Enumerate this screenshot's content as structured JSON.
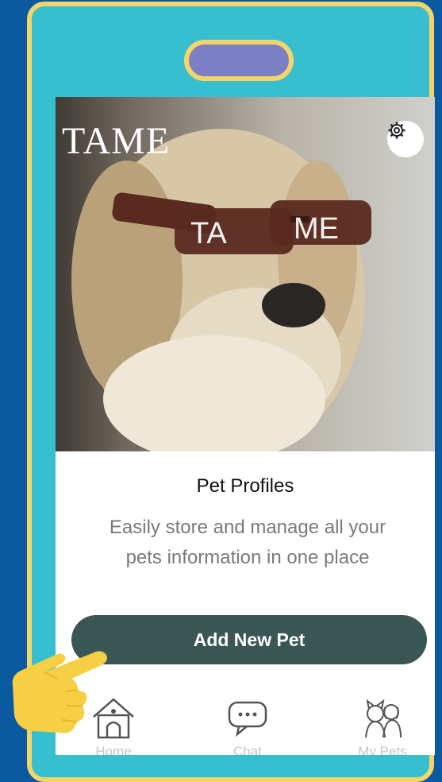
{
  "app": {
    "brand": "TAME"
  },
  "hero": {
    "glasses_left": "TA",
    "glasses_right": "ME"
  },
  "card": {
    "title": "Pet Profiles",
    "description": "Easily store and manage all your pets information in one place",
    "button_label": "Add New Pet"
  },
  "tabs": [
    {
      "label": "Home",
      "icon": "doghouse-icon"
    },
    {
      "label": "Chat",
      "icon": "chat-bubble-icon"
    },
    {
      "label": "My Pets",
      "icon": "pets-icon"
    }
  ],
  "colors": {
    "background": "#0b5aa0",
    "frame": "#38bfcf",
    "frame_border": "#f5d46a",
    "notch": "#7d7fc4",
    "button": "#3b5755",
    "hand": "#f7cf45"
  }
}
